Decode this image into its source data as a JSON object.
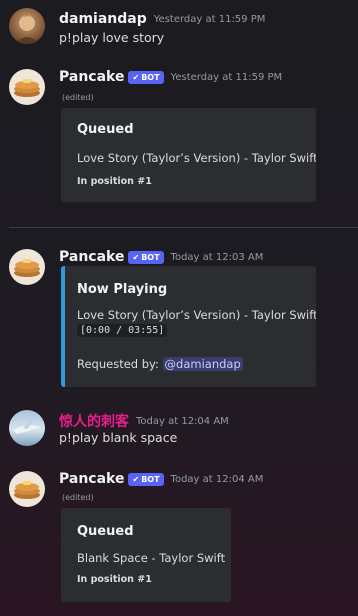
{
  "messages": {
    "m1": {
      "author": "damiandap",
      "time": "Yesterday at 11:59 PM",
      "text": "p!play love story"
    },
    "m2": {
      "author": "Pancake",
      "bot_label": "BOT",
      "time": "Yesterday at 11:59 PM",
      "edited": "(edited)",
      "embed": {
        "title": "Queued",
        "line": "Love Story (Taylor’s Version) - Taylor Swift",
        "small": "In position #1"
      }
    },
    "m3": {
      "author": "Pancake",
      "bot_label": "BOT",
      "time": "Today at 12:03 AM",
      "embed": {
        "title": "Now Playing",
        "line": "Love Story (Taylor’s Version) - Taylor Swift",
        "code": "[0:00 / 03:55]",
        "requested_label": "Requested by:",
        "mention": "@damiandap"
      }
    },
    "m4": {
      "author": "惊人的刺客",
      "time": "Today at 12:04 AM",
      "text": "p!play blank space"
    },
    "m5": {
      "author": "Pancake",
      "bot_label": "BOT",
      "time": "Today at 12:04 AM",
      "edited": "(edited)",
      "embed": {
        "title": "Queued",
        "line": "Blank Space - Taylor Swift",
        "small": "In position #1"
      }
    }
  },
  "colors": {
    "bot_tag": "#5865f2",
    "now_playing_bar": "#3498db",
    "pink_username": "#e91e8c"
  },
  "icons": {
    "bot_check": "checkmark-icon"
  }
}
